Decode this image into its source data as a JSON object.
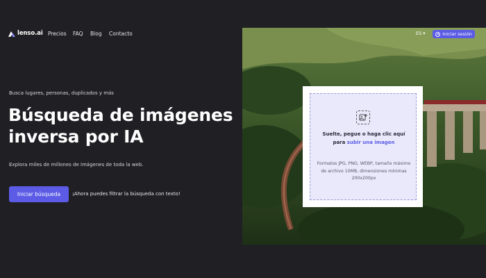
{
  "navbar": {
    "brand": "lenso.ai",
    "links": [
      "Precios",
      "FAQ",
      "Blog",
      "Contacto"
    ],
    "language": "ES",
    "signin_label": "Iniciar sesión"
  },
  "hero": {
    "tagline": "Busca lugares, personas, duplicados y más",
    "headline_line1": "Búsqueda de imágenes",
    "headline_line2": "inversa por IA",
    "subtitle": "Explora miles de millones de imágenes de toda la web.",
    "cta_label": "Iniciar búsqueda",
    "cta_note": "¡Ahora puedes filtrar la búsqueda con texto!"
  },
  "upload": {
    "prompt_prefix": "Suelte, pegue o haga clic aquí para",
    "link_text": "subir una imagen",
    "formats_text": "Formatos JPG, PNG, WEBP, tamaño máximo de archivo 10MB, dimensiones mínimas 200x200px"
  },
  "colors": {
    "background": "#1f1f24",
    "accent": "#5b5be6",
    "dropzone": "#e9e9fb"
  }
}
